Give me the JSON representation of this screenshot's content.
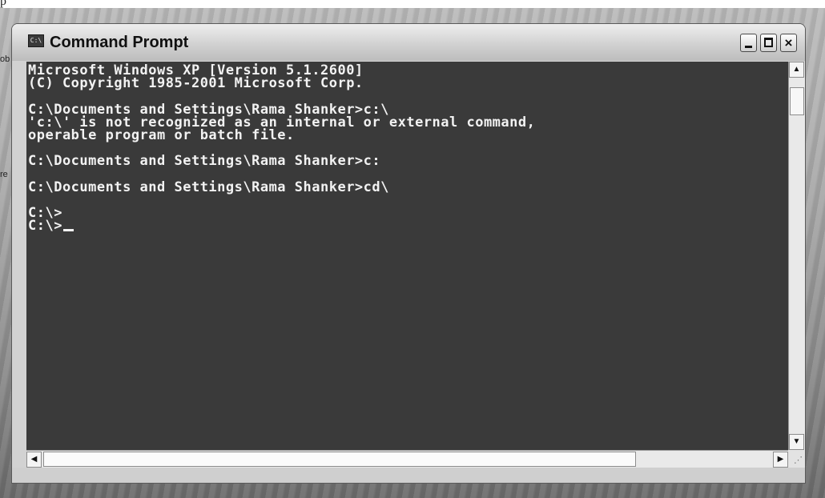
{
  "desktop": {
    "corner_glyph": "p",
    "fragment_a": "ob",
    "fragment_b": "re"
  },
  "window": {
    "title": "Command Prompt",
    "icon_label": "C:\\",
    "controls": {
      "minimize": "minimize",
      "maximize": "maximize",
      "close": "×"
    }
  },
  "console": {
    "lines": [
      "Microsoft Windows XP [Version 5.1.2600]",
      "(C) Copyright 1985-2001 Microsoft Corp.",
      "",
      "C:\\Documents and Settings\\Rama Shanker>c:\\",
      "'c:\\' is not recognized as an internal or external command,",
      "operable program or batch file.",
      "",
      "C:\\Documents and Settings\\Rama Shanker>c:",
      "",
      "C:\\Documents and Settings\\Rama Shanker>cd\\",
      "",
      "C:\\>",
      "C:\\>"
    ]
  },
  "scrollbars": {
    "up_arrow": "▲",
    "down_arrow": "▼",
    "left_arrow": "◀",
    "right_arrow": "▶"
  },
  "colors": {
    "console_bg": "#3a3a3a",
    "console_fg": "#f2f2f2"
  }
}
